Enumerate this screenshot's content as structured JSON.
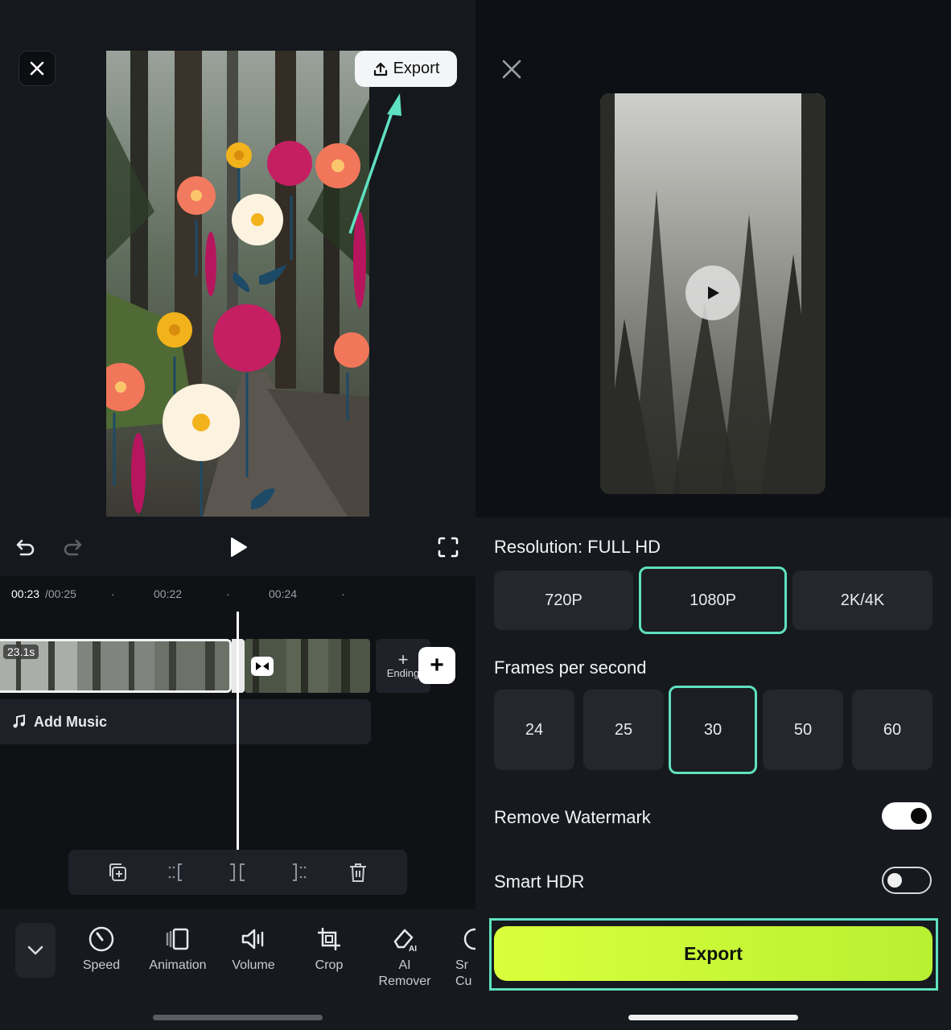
{
  "editor": {
    "export_label": "Export",
    "time_current": "00:23",
    "time_total": "/00:25",
    "tick_1": "00:22",
    "tick_2": "00:24",
    "clip_duration": "23.1s",
    "ending_label": "Ending",
    "add_music_label": "Add Music",
    "tools": [
      {
        "label": "Speed",
        "icon": "speed-icon"
      },
      {
        "label": "Animation",
        "icon": "animation-icon"
      },
      {
        "label": "Volume",
        "icon": "volume-icon"
      },
      {
        "label": "Crop",
        "icon": "crop-icon"
      },
      {
        "label": "AI Remover",
        "line1": "AI",
        "line2": "Remover",
        "icon": "ai-remover-icon"
      },
      {
        "label": "Sr Cu",
        "line1": "Sr",
        "line2": "Cu",
        "icon": "smart-cutout-icon"
      }
    ]
  },
  "export_panel": {
    "resolution_label": "Resolution: FULL HD",
    "resolution_options": [
      "720P",
      "1080P",
      "2K/4K"
    ],
    "resolution_selected": "1080P",
    "fps_label": "Frames per second",
    "fps_options": [
      "24",
      "25",
      "30",
      "50",
      "60"
    ],
    "fps_selected": "30",
    "remove_watermark_label": "Remove Watermark",
    "remove_watermark_on": true,
    "smart_hdr_label": "Smart HDR",
    "smart_hdr_on": false,
    "export_button_label": "Export"
  },
  "colors": {
    "accent": "#5fe1c1",
    "export_button": "#c6f736",
    "panel_bg": "#16191e"
  }
}
